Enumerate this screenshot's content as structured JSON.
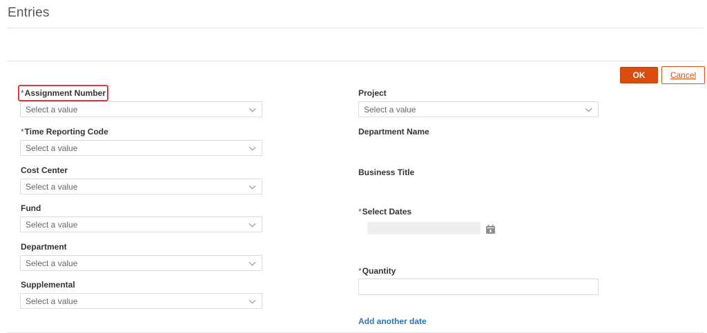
{
  "page": {
    "title": "Entries"
  },
  "actions": {
    "ok_label": "OK",
    "cancel_label": "Cancel"
  },
  "required_marker": "*",
  "left_fields": [
    {
      "label": "Assignment Number",
      "required": true,
      "placeholder": "Select a value"
    },
    {
      "label": "Time Reporting Code",
      "required": true,
      "placeholder": "Select a value"
    },
    {
      "label": "Cost Center",
      "required": false,
      "placeholder": "Select a value"
    },
    {
      "label": "Fund",
      "required": false,
      "placeholder": "Select a value"
    },
    {
      "label": "Department",
      "required": false,
      "placeholder": "Select a value"
    },
    {
      "label": "Supplemental",
      "required": false,
      "placeholder": "Select a value"
    }
  ],
  "right_fields": {
    "project": {
      "label": "Project",
      "placeholder": "Select a value"
    },
    "department_name": {
      "label": "Department Name"
    },
    "business_title": {
      "label": "Business Title"
    },
    "select_dates": {
      "label": "Select Dates",
      "required": true,
      "icon": "calendar-icon"
    },
    "quantity": {
      "label": "Quantity",
      "required": true,
      "value": ""
    }
  },
  "add_date_link": "Add another date",
  "colors": {
    "accent": "#d94e0f",
    "link": "#2d73b5",
    "highlight": "#e0383a"
  }
}
